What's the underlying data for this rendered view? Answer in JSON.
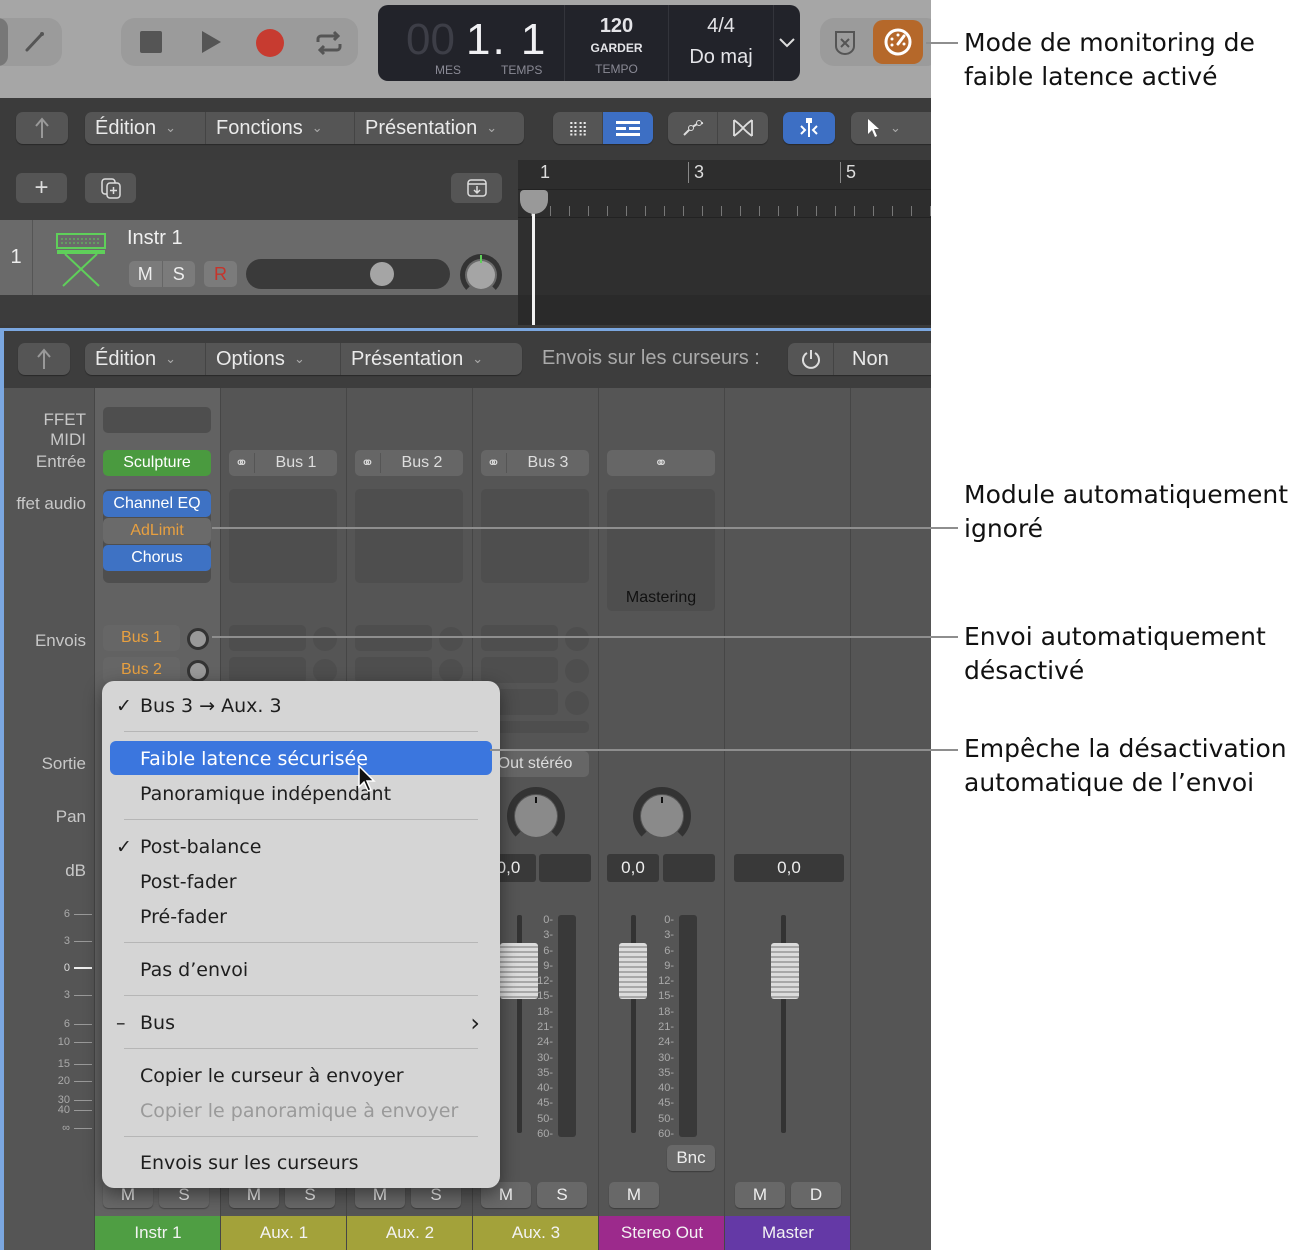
{
  "control_bar": {
    "lcd": {
      "position_dim": "00",
      "position": "1. 1",
      "bar_label": "MES",
      "beat_label": "TEMPS",
      "tempo": "120",
      "tempo_mode": "GARDER",
      "tempo_label": "TEMPO",
      "signature": "4/4",
      "key": "Do maj"
    },
    "low_latency_color": "#b5682a"
  },
  "tracks_toolbar": {
    "menus": [
      "Édition",
      "Fonctions",
      "Présentation"
    ]
  },
  "ruler": {
    "marks": [
      "1",
      "3",
      "5"
    ]
  },
  "track": {
    "number": "1",
    "name": "Instr 1",
    "mute": "M",
    "solo": "S",
    "record": "R",
    "volume_level": 0.7
  },
  "mixer_toolbar": {
    "menus": [
      "Édition",
      "Options",
      "Présentation"
    ],
    "sends_on_faders_label": "Envois sur les curseurs :",
    "sends_on_faders_value": "Non"
  },
  "row_labels": {
    "midi_fx": "FFET MIDI",
    "input": "Entrée",
    "audio_fx": "ffet audio",
    "sends": "Envois",
    "output": "Sortie",
    "pan": "Pan",
    "db": "dB"
  },
  "db_scale_left": [
    "6",
    "3",
    "0",
    "3",
    "6",
    "10",
    "15",
    "20",
    "30",
    "40",
    "∞"
  ],
  "db_scale_meter": [
    "0",
    "3",
    "6",
    "9",
    "12",
    "15",
    "18",
    "21",
    "24",
    "30",
    "35",
    "40",
    "45",
    "50",
    "60"
  ],
  "strips": [
    {
      "name": "Instr 1",
      "color": "#4f9e43",
      "input": "Sculpture",
      "plugins": [
        "Channel EQ",
        "AdLimit",
        "Chorus"
      ],
      "sends": [
        "Bus 1",
        "Bus 2"
      ],
      "mute": "M",
      "solo": "S"
    },
    {
      "name": "Aux. 1",
      "color": "#a3a23a",
      "input": "Bus 1",
      "mute": "M",
      "solo": "S"
    },
    {
      "name": "Aux. 2",
      "color": "#a3a23a",
      "input": "Bus 2",
      "mute": "M",
      "solo": "S"
    },
    {
      "name": "Aux. 3",
      "color": "#a3a23a",
      "input": "Bus 3",
      "output": "Out stéréo",
      "db": "0,0",
      "mute": "M",
      "solo": "S"
    },
    {
      "name": "Stereo Out",
      "color": "#9c2a8c",
      "effect": "Mastering",
      "db": "0,0",
      "bounce": "Bnc",
      "mute": "M"
    },
    {
      "name": "Master",
      "color": "#6439a6",
      "db": "0,0",
      "mute": "M",
      "dim": "D"
    }
  ],
  "context_menu": {
    "items": [
      {
        "label": "Bus 3 → Aux. 3",
        "check": "✓"
      },
      {
        "label": "Faible latence sécurisée",
        "highlighted": true
      },
      {
        "label": "Panoramique indépendant"
      },
      {
        "label": "Post-balance",
        "check": "✓"
      },
      {
        "label": "Post-fader"
      },
      {
        "label": "Pré-fader"
      },
      {
        "label": "Pas d’envoi"
      },
      {
        "label": "Bus",
        "check": "–",
        "submenu": "›"
      },
      {
        "label": "Copier le curseur à envoyer"
      },
      {
        "label": "Copier le panoramique à envoyer",
        "disabled": true
      },
      {
        "label": "Envois sur les curseurs"
      }
    ]
  },
  "callouts": [
    "Mode de monitoring de faible latence activé",
    "Module automatiquement ignoré",
    "Envoi automatiquement désactivé",
    "Empêche la désactivation automatique de l’envoi"
  ]
}
